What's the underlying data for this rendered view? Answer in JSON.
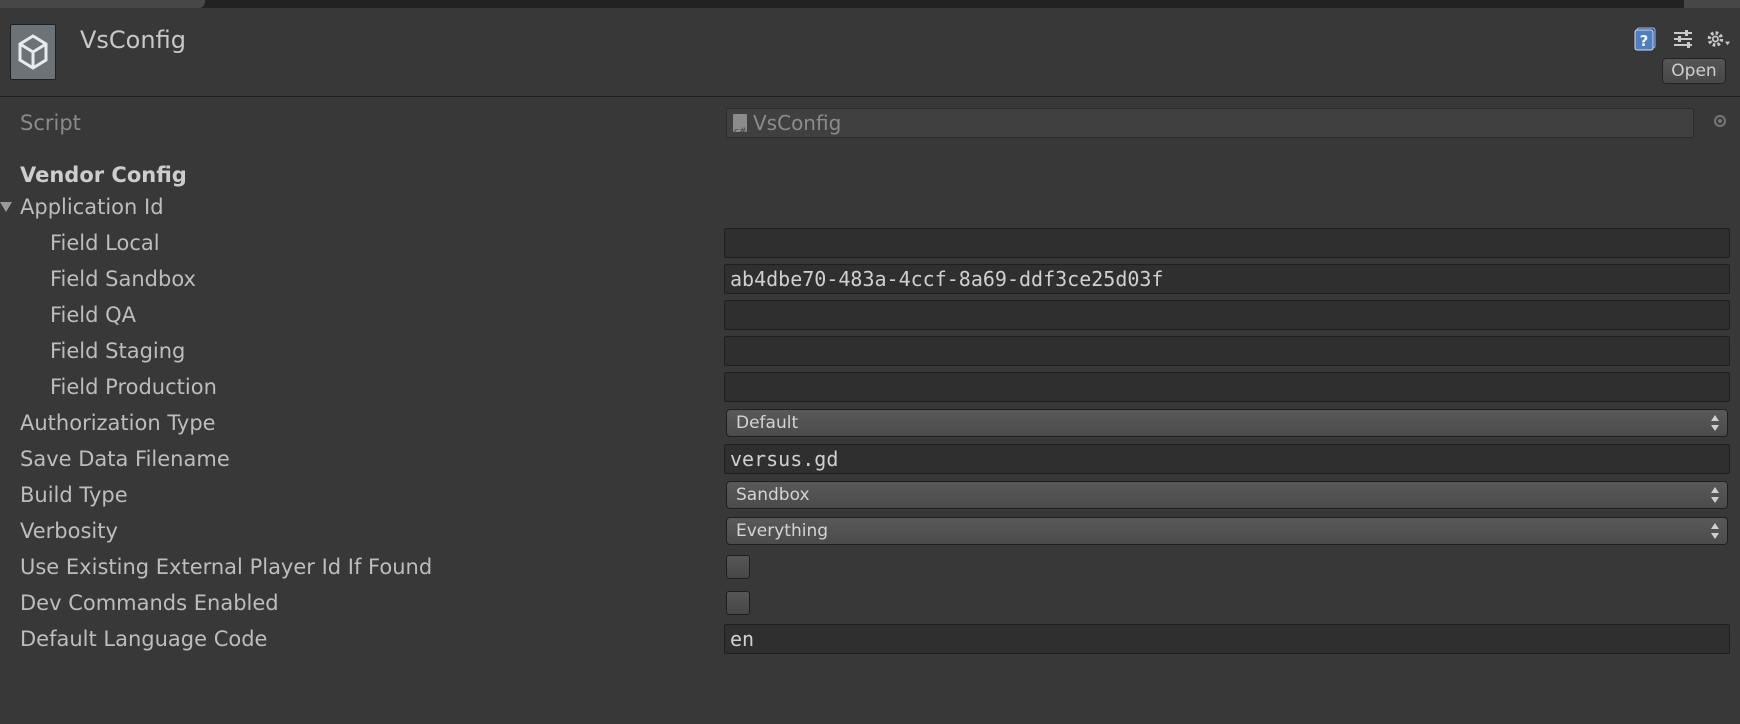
{
  "header": {
    "title": "VsConfig",
    "open_label": "Open",
    "icons": [
      "unity-logo-icon",
      "help-icon",
      "presets-icon",
      "gear-icon"
    ]
  },
  "script": {
    "label": "Script",
    "value": "VsConfig"
  },
  "section_title": "Vendor Config",
  "application_id": {
    "label": "Application Id",
    "expanded": true,
    "fields": [
      {
        "label": "Field Local",
        "value": ""
      },
      {
        "label": "Field Sandbox",
        "value": "ab4dbe70-483a-4ccf-8a69-ddf3ce25d03f"
      },
      {
        "label": "Field QA",
        "value": ""
      },
      {
        "label": "Field Staging",
        "value": ""
      },
      {
        "label": "Field Production",
        "value": ""
      }
    ]
  },
  "authorization_type": {
    "label": "Authorization Type",
    "value": "Default"
  },
  "save_data_filename": {
    "label": "Save Data Filename",
    "value": "versus.gd"
  },
  "build_type": {
    "label": "Build Type",
    "value": "Sandbox"
  },
  "verbosity": {
    "label": "Verbosity",
    "value": "Everything"
  },
  "use_existing_external_player_id": {
    "label": "Use Existing External Player Id If Found",
    "checked": false
  },
  "dev_commands_enabled": {
    "label": "Dev Commands Enabled",
    "checked": false
  },
  "default_language_code": {
    "label": "Default Language Code",
    "value": "en"
  },
  "colors": {
    "background": "#383838",
    "field_background": "#2f2f2f",
    "text": "#c4c4c4",
    "help_icon": "#4f7fc0"
  }
}
